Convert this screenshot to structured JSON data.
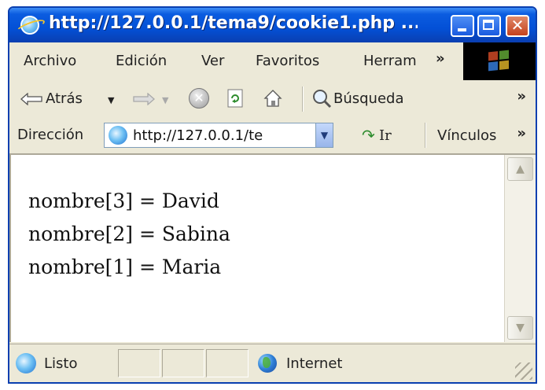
{
  "window": {
    "title": "http://127.0.0.1/tema9/cookie1.php ..."
  },
  "menu": {
    "items": [
      "Archivo",
      "Edición",
      "Ver",
      "Favoritos",
      "Herram"
    ],
    "overflow": "»"
  },
  "toolbar": {
    "back_label": "Atrás",
    "search_label": "Búsqueda",
    "overflow": "»"
  },
  "address": {
    "label": "Dirección",
    "value": "http://127.0.0.1/te",
    "go_label": "Ir",
    "links_label": "Vínculos",
    "overflow": "»"
  },
  "page": {
    "lines": [
      "nombre[3] = David",
      "nombre[2] = Sabina",
      "nombre[1] = Maria"
    ]
  },
  "status": {
    "text": "Listo",
    "zone": "Internet"
  },
  "colors": {
    "title_bar": "#0350d6",
    "chrome": "#ece9d8",
    "content_bg": "#ffffff"
  }
}
